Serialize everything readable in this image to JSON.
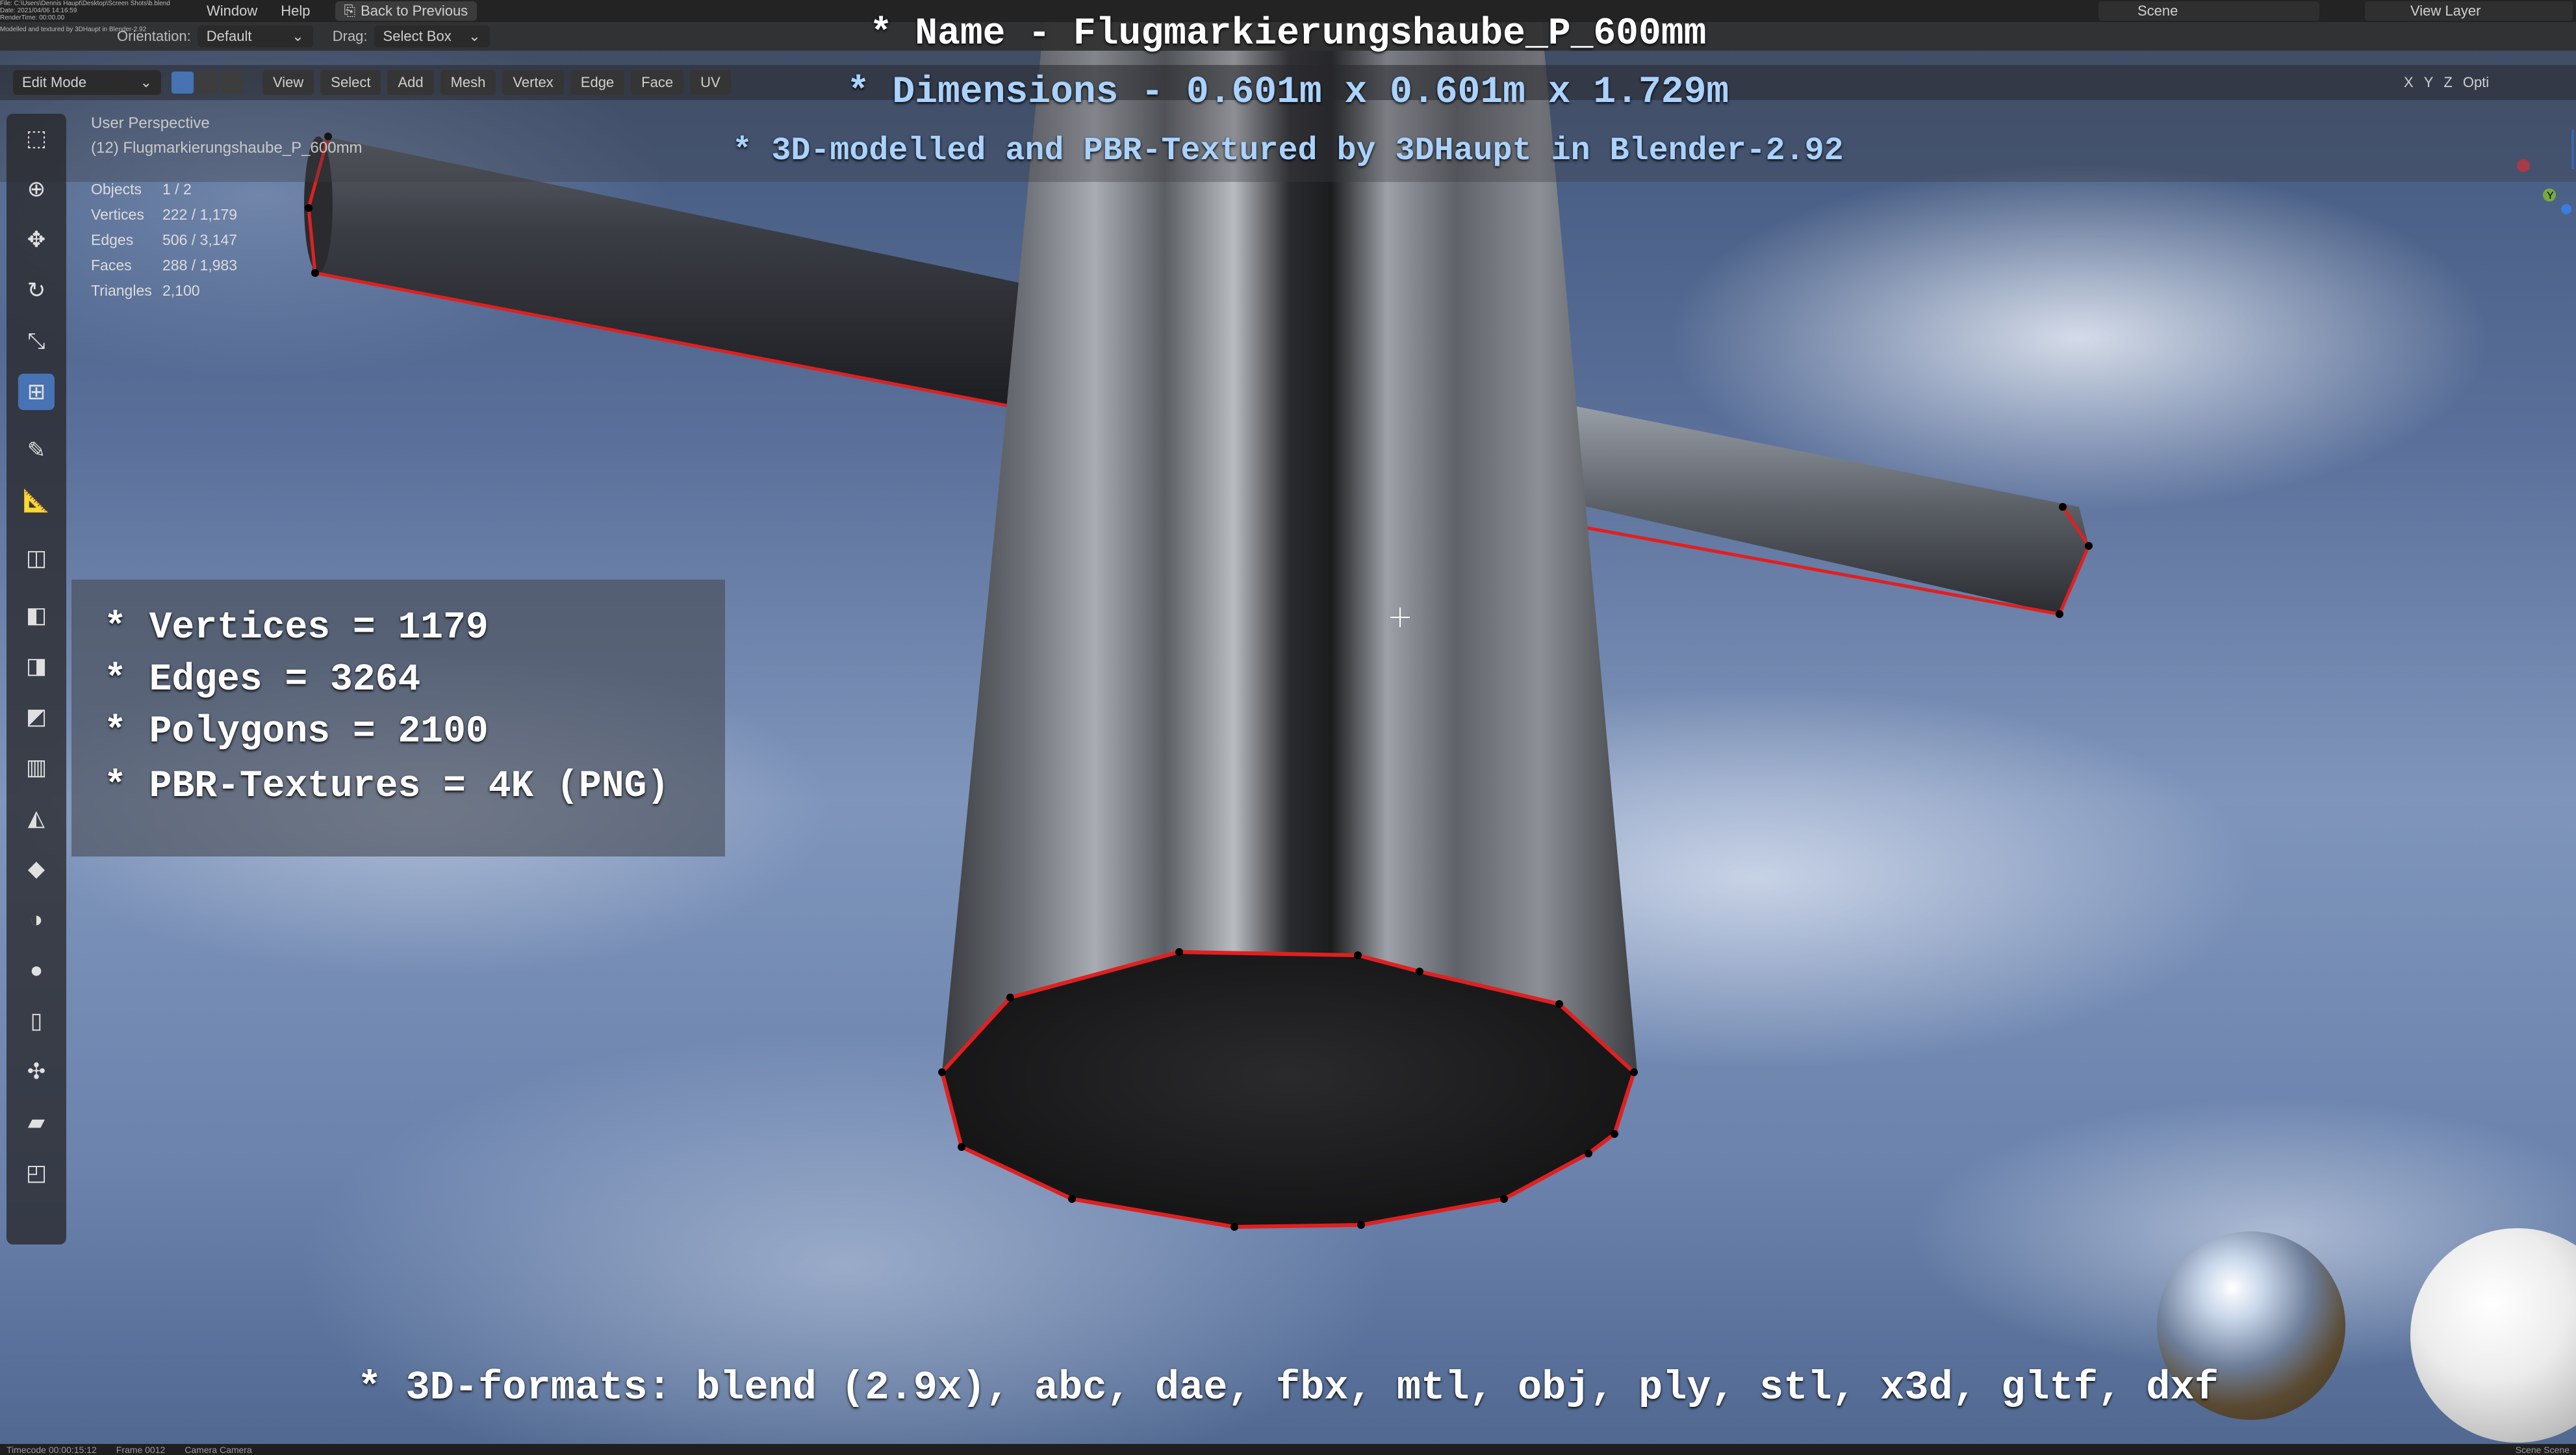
{
  "colors": {
    "accent_blue": "#4772b3",
    "edge_red": "#e02020",
    "title_white": "#ffffff",
    "title_blue": "#a9d2ff"
  },
  "topbar": {
    "info_lines": [
      "File: C:\\Users\\Dennis Haupt\\Desktop\\Screen Shots\\b.blend",
      "Date: 2021/04/06 14:16:59",
      "RenderTime: 00:00.00",
      "Modelled and textured by 3DHaupt in Blender-2.92"
    ],
    "menus": [
      "Window",
      "Help"
    ],
    "back_label": "Back to Previous",
    "scene_label": "Scene",
    "layer_label": "View Layer"
  },
  "toolbar2": {
    "orientation_label": "Orientation:",
    "orientation_value": "Default",
    "drag_label": "Drag:",
    "drag_value": "Select Box"
  },
  "toolbar3": {
    "mode": "Edit Mode",
    "menus": [
      "View",
      "Select",
      "Add",
      "Mesh",
      "Vertex",
      "Edge",
      "Face",
      "UV"
    ],
    "axes": [
      "X",
      "Y",
      "Z"
    ],
    "options_label": "Opti"
  },
  "viewport": {
    "perspective": "User Perspective",
    "object_name": "(12) Flugmarkierungshaube_P_600mm",
    "stats": [
      {
        "label": "Objects",
        "value": "1 / 2"
      },
      {
        "label": "Vertices",
        "value": "222 / 1,179"
      },
      {
        "label": "Edges",
        "value": "506 / 3,147"
      },
      {
        "label": "Faces",
        "value": "288 / 1,983"
      },
      {
        "label": "Triangles",
        "value": "2,100"
      }
    ]
  },
  "titles": {
    "name": "* Name - Flugmarkierungshaube_P_600mm",
    "dimensions": "* Dimensions -  0.601m x 0.601m x 1.729m",
    "credit": "* 3D-modelled and PBR-Textured by 3DHaupt in Blender-2.92"
  },
  "info": [
    "* Vertices = 1179",
    "* Edges = 3264",
    "* Polygons = 2100",
    "* PBR-Textures = 4K (PNG)"
  ],
  "formats": "* 3D-formats: blend (2.9x), abc, dae, fbx, mtl, obj, ply, stl, x3d, gltf, dxf",
  "statusbar": [
    "Timecode 00:00:15:12",
    "Frame 0012",
    "Camera Camera"
  ],
  "statusbar_right": "Scene Scene",
  "tools": [
    "select-box-icon",
    "cursor-icon",
    "move-icon",
    "rotate-icon",
    "scale-icon",
    "transform-icon",
    "annotate-icon",
    "measure-icon",
    "add-cube-icon",
    "extrude-icon",
    "inset-icon",
    "bevel-icon",
    "loop-cut-icon",
    "knife-icon",
    "poly-build-icon",
    "spin-icon",
    "smooth-icon",
    "edge-slide-icon",
    "shrink-icon",
    "shear-icon",
    "rip-icon"
  ]
}
